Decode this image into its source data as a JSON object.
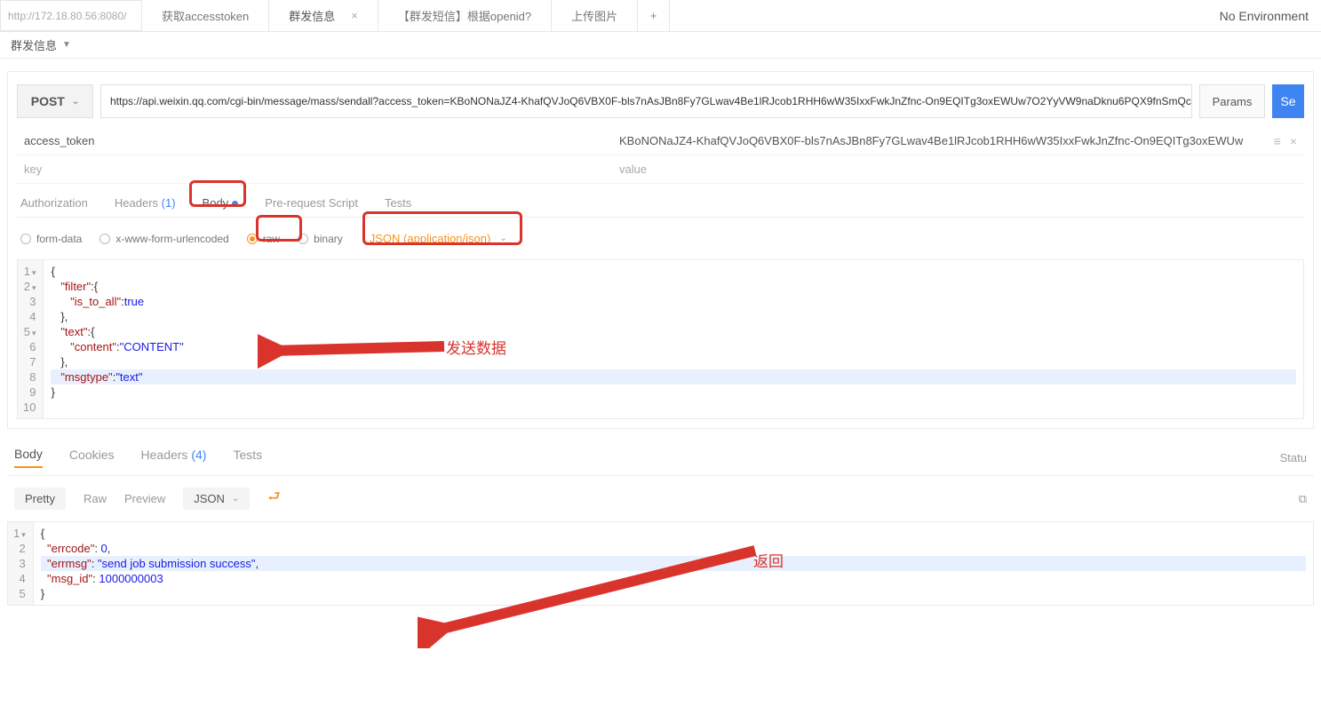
{
  "topbar": {
    "url": "http://172.18.80.56:8080/",
    "tabs": [
      "获取accesstoken",
      "群发信息",
      "【群发短信】根据openid?",
      "上传图片"
    ],
    "activeTab": 1,
    "env": "No Environment"
  },
  "breadcrumb": "群发信息",
  "request": {
    "method": "POST",
    "url": "https://api.weixin.qq.com/cgi-bin/message/mass/sendall?access_token=KBoNONaJZ4-KhafQVJoQ6VBX0F-bls7nAsJBn8Fy7GLwav4Be1lRJcob1RHH6wW35IxxFwkJnZfnc-On9EQITg3oxEWUw7O2YyVW9naDknu6PQX9fnSmQc",
    "params_label": "Params",
    "send_label": "Se",
    "params": [
      {
        "key": "access_token",
        "value": "KBoNONaJZ4-KhafQVJoQ6VBX0F-bls7nAsJBn8Fy7GLwav4Be1lRJcob1RHH6wW35IxxFwkJnZfnc-On9EQITg3oxEWUw"
      }
    ],
    "placeholder_key": "key",
    "placeholder_value": "value"
  },
  "innerTabs": {
    "auth": "Authorization",
    "headers": "Headers",
    "headers_count": "(1)",
    "body": "Body",
    "prerequest": "Pre-request Script",
    "tests": "Tests"
  },
  "bodyTypes": {
    "formdata": "form-data",
    "urlencoded": "x-www-form-urlencoded",
    "raw": "raw",
    "binary": "binary",
    "contentType": "JSON (application/json)"
  },
  "requestBody": {
    "lines": [
      "{",
      "   \"filter\":{",
      "      \"is_to_all\":true",
      "   },",
      "   \"text\":{",
      "      \"content\":\"CONTENT\"",
      "   },",
      "   \"msgtype\":\"text\"",
      "}",
      ""
    ]
  },
  "annotations": {
    "sendData": "发送数据",
    "response": "返回"
  },
  "response": {
    "tabs": {
      "body": "Body",
      "cookies": "Cookies",
      "headers": "Headers",
      "headers_count": "(4)",
      "tests": "Tests"
    },
    "status_label": "Statu",
    "viewModes": {
      "pretty": "Pretty",
      "raw": "Raw",
      "preview": "Preview",
      "json": "JSON"
    },
    "body": {
      "lines": [
        "{",
        "  \"errcode\": 0,",
        "  \"errmsg\": \"send job submission success\",",
        "  \"msg_id\": 1000000003",
        "}"
      ]
    }
  }
}
